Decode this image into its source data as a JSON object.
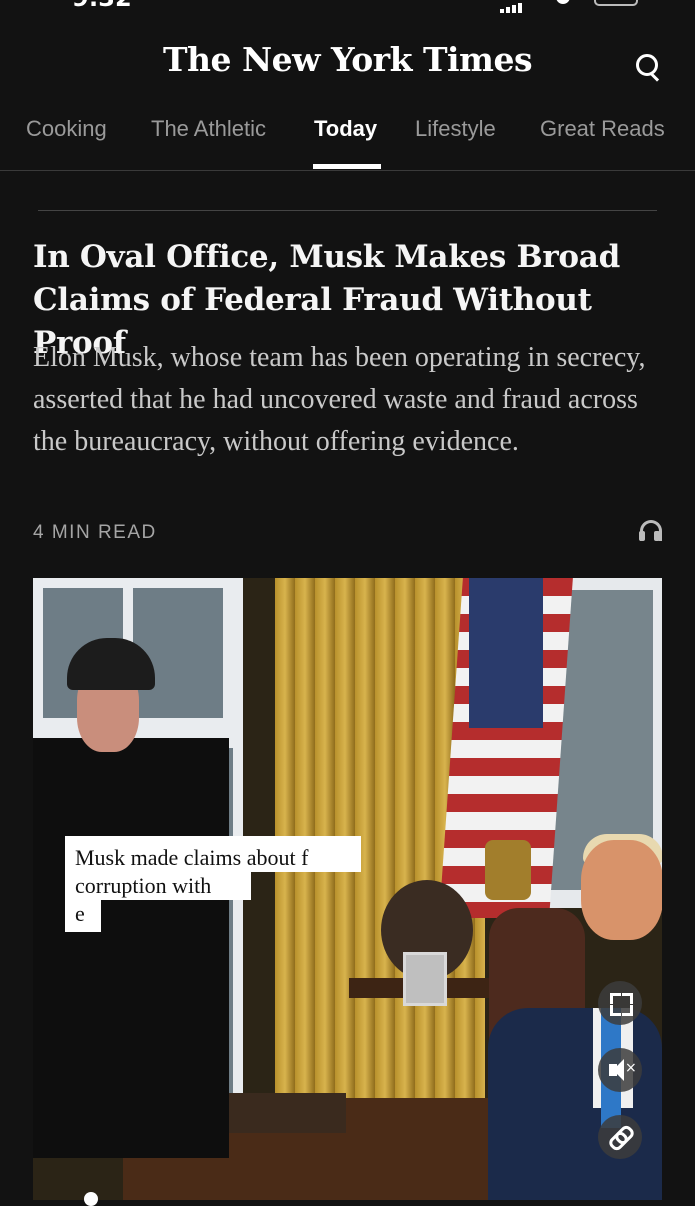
{
  "status_bar": {
    "time": "9:32"
  },
  "masthead": {
    "logo": "The New York Times",
    "search_icon": "search-icon"
  },
  "tabs": [
    {
      "label": "Cooking",
      "active": false
    },
    {
      "label": "The Athletic",
      "active": false
    },
    {
      "label": "Today",
      "active": true
    },
    {
      "label": "Lifestyle",
      "active": false
    },
    {
      "label": "Great Reads",
      "active": false
    }
  ],
  "article": {
    "headline": "In Oval Office, Musk Makes Broad Claims of Federal Fraud Without Proof",
    "summary": "Elon Musk, whose team has been operating in secrecy, asserted that he had uncovered waste and fraud across the bureaucracy, without offering evidence.",
    "read_time": "4 MIN READ",
    "audio_icon": "headphones-icon"
  },
  "video": {
    "caption_lines": [
      "Musk made claims about f",
      "corruption with",
      "e"
    ],
    "controls": [
      "fullscreen-icon",
      "mute-icon",
      "link-icon"
    ]
  },
  "colors": {
    "background": "#121212",
    "text": "#f2f2f2",
    "muted": "#a5a5a5"
  }
}
